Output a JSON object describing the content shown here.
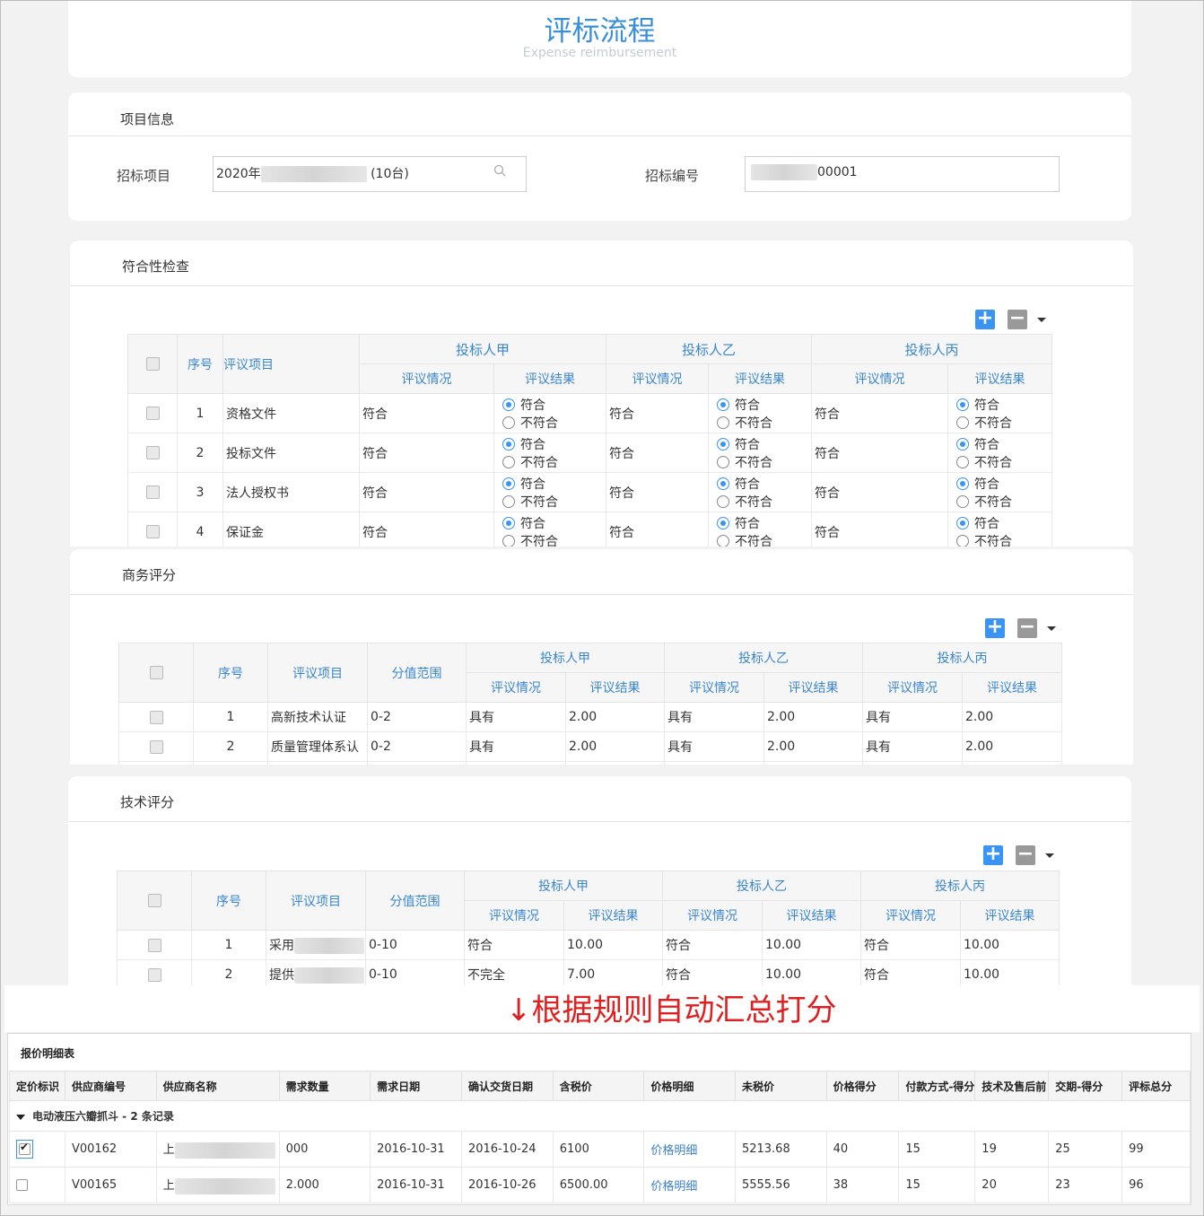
{
  "header": {
    "title": "评标流程",
    "subtitle": "Expense reimbursement"
  },
  "project_info": {
    "section_title": "项目信息",
    "bid_project_label": "招标项目",
    "bid_project_value_prefix": "2020年",
    "bid_project_value_suffix": "(10台)",
    "bid_number_label": "招标编号",
    "bid_number_value_suffix": "00001"
  },
  "compliance": {
    "section_title": "符合性检查",
    "headers": {
      "seq": "序号",
      "item": "评议项目",
      "situation": "评议情况",
      "result": "评议结果"
    },
    "bidders": [
      "投标人甲",
      "投标人乙",
      "投标人丙"
    ],
    "radio_options": [
      "符合",
      "不符合"
    ],
    "rows": [
      {
        "seq": "1",
        "item": "资格文件",
        "situations": [
          "符合",
          "符合",
          "符合"
        ]
      },
      {
        "seq": "2",
        "item": "投标文件",
        "situations": [
          "符合",
          "符合",
          "符合"
        ]
      },
      {
        "seq": "3",
        "item": "法人授权书",
        "situations": [
          "符合",
          "符合",
          "符合"
        ]
      },
      {
        "seq": "4",
        "item": "保证金",
        "situations": [
          "符合",
          "符合",
          "符合"
        ]
      }
    ]
  },
  "business": {
    "section_title": "商务评分",
    "headers": {
      "seq": "序号",
      "item": "评议项目",
      "range": "分值范围",
      "situation": "评议情况",
      "result": "评议结果"
    },
    "bidders": [
      "投标人甲",
      "投标人乙",
      "投标人丙"
    ],
    "rows": [
      {
        "seq": "1",
        "item": "高新技术认证",
        "range": "0-2",
        "cells": [
          "具有",
          "2.00",
          "具有",
          "2.00",
          "具有",
          "2.00"
        ]
      },
      {
        "seq": "2",
        "item": "质量管理体系认",
        "range": "0-2",
        "cells": [
          "具有",
          "2.00",
          "具有",
          "2.00",
          "具有",
          "2.00"
        ]
      }
    ]
  },
  "technical": {
    "section_title": "技术评分",
    "headers": {
      "seq": "序号",
      "item": "评议项目",
      "range": "分值范围",
      "situation": "评议情况",
      "result": "评议结果"
    },
    "bidders": [
      "投标人甲",
      "投标人乙",
      "投标人丙"
    ],
    "rows": [
      {
        "seq": "1",
        "item": "采用",
        "range": "0-10",
        "cells": [
          "符合",
          "10.00",
          "符合",
          "10.00",
          "符合",
          "10.00"
        ]
      },
      {
        "seq": "2",
        "item": "提供",
        "range": "0-10",
        "cells": [
          "不完全",
          "7.00",
          "符合",
          "10.00",
          "符合",
          "10.00"
        ]
      }
    ]
  },
  "annotation": "↓根据规则自动汇总打分",
  "price_table": {
    "title": "报价明细表",
    "columns": [
      "定价标识",
      "供应商编号",
      "供应商名称",
      "需求数量",
      "需求日期",
      "确认交货日期",
      "含税价",
      "价格明细",
      "未税价",
      "价格得分",
      "付款方式-得分",
      "技术及售后前",
      "交期-得分",
      "评标总分"
    ],
    "group_label": "电动液压六瓣抓斗 - 2 条记录",
    "rows": [
      {
        "checked": true,
        "vendor_no": "V00162",
        "vendor_name": "上",
        "qty": "000",
        "req_date": "2016-10-31",
        "confirm_date": "2016-10-24",
        "tax_price": "6100",
        "detail": "价格明细",
        "net_price": "5213.68",
        "price_score": "40",
        "payment_score": "15",
        "tech_score": "19",
        "delivery_score": "25",
        "total": "99"
      },
      {
        "checked": false,
        "vendor_no": "V00165",
        "vendor_name": "上",
        "qty": "2.000",
        "req_date": "2016-10-31",
        "confirm_date": "2016-10-26",
        "tax_price": "6500.00",
        "detail": "价格明细",
        "net_price": "5555.56",
        "price_score": "38",
        "payment_score": "15",
        "tech_score": "20",
        "delivery_score": "23",
        "total": "96"
      }
    ]
  },
  "colors": {
    "accent": "#3a94f3",
    "title_blue": "#3a8fd9",
    "annotation_red": "#e02020"
  }
}
